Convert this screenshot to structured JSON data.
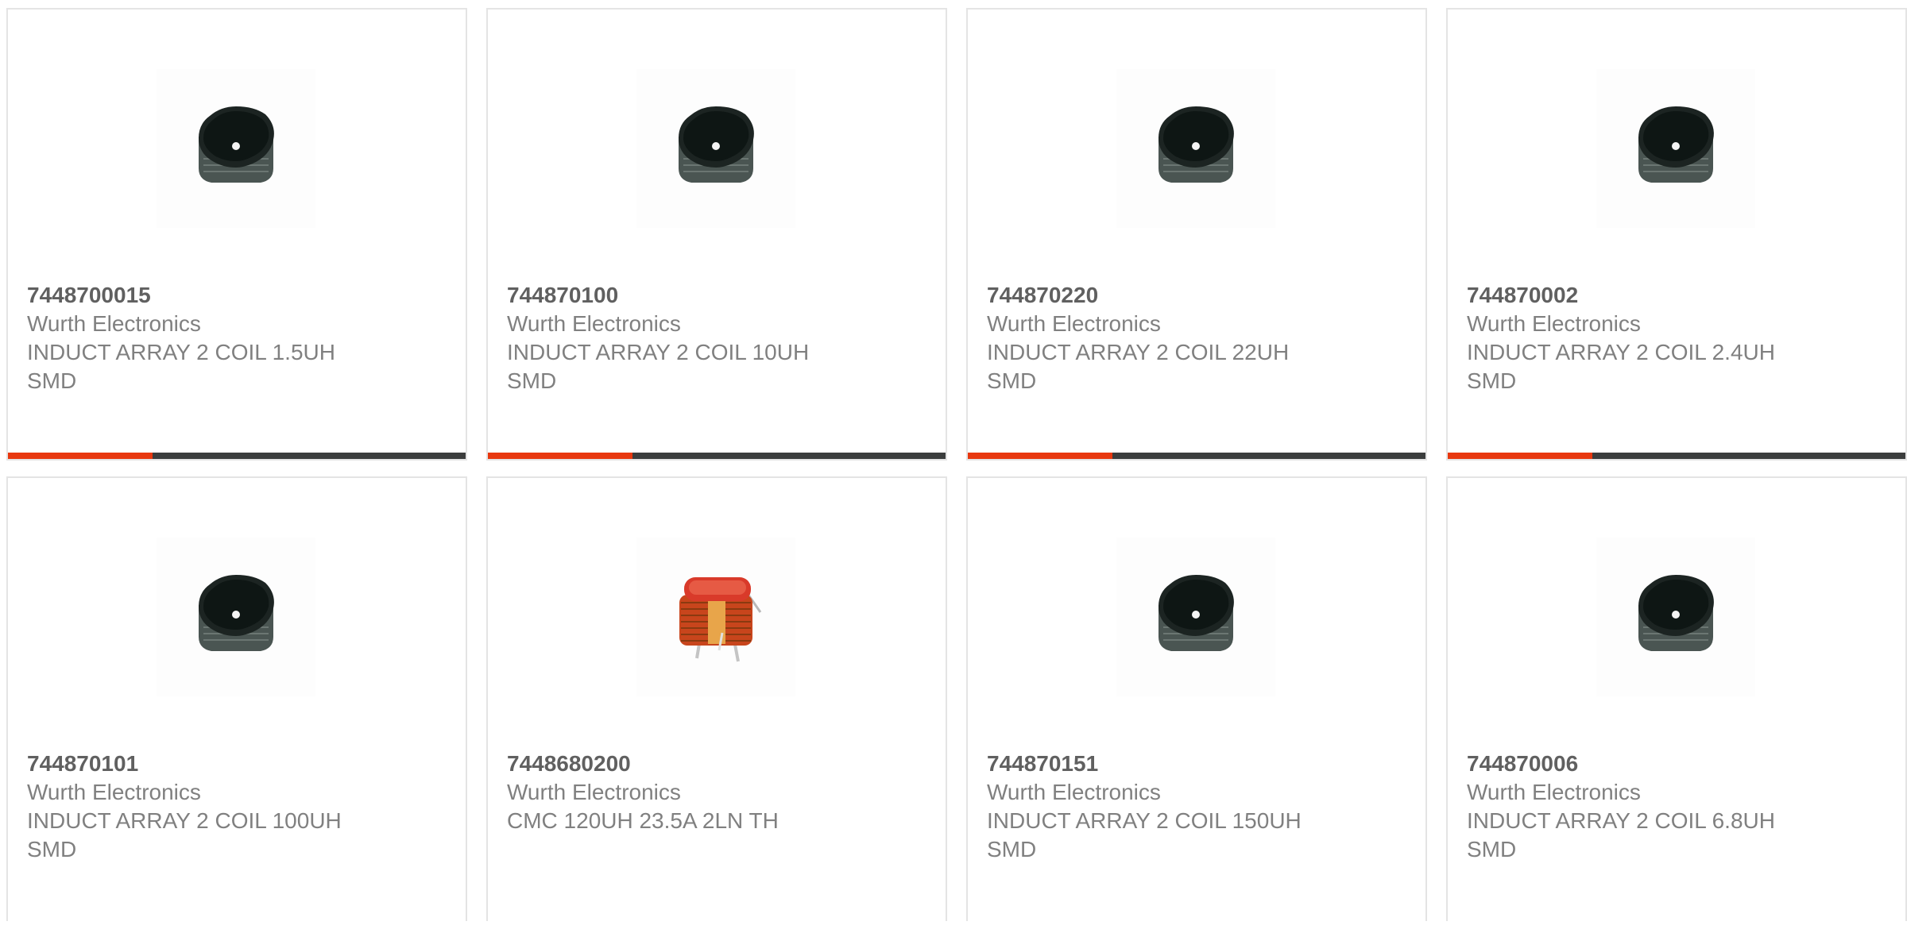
{
  "products": [
    {
      "part_number": "7448700015",
      "manufacturer": "Wurth Electronics",
      "description": "INDUCT ARRAY 2 COIL 1.5UH",
      "package": "SMD",
      "image": "smd-inductor-image",
      "show_bar": true
    },
    {
      "part_number": "744870100",
      "manufacturer": "Wurth Electronics",
      "description": "INDUCT ARRAY 2 COIL 10UH",
      "package": "SMD",
      "image": "smd-inductor-image",
      "show_bar": true
    },
    {
      "part_number": "744870220",
      "manufacturer": "Wurth Electronics",
      "description": "INDUCT ARRAY 2 COIL 22UH",
      "package": "SMD",
      "image": "smd-inductor-image",
      "show_bar": true
    },
    {
      "part_number": "744870002",
      "manufacturer": "Wurth Electronics",
      "description": "INDUCT ARRAY 2 COIL 2.4UH",
      "package": "SMD",
      "image": "smd-inductor-image",
      "show_bar": true
    },
    {
      "part_number": "744870101",
      "manufacturer": "Wurth Electronics",
      "description": "INDUCT ARRAY 2 COIL 100UH",
      "package": "SMD",
      "image": "smd-inductor-image",
      "show_bar": false
    },
    {
      "part_number": "7448680200",
      "manufacturer": "Wurth Electronics",
      "description": "CMC 120UH 23.5A 2LN TH",
      "package": "",
      "image": "common-mode-choke-image",
      "show_bar": false
    },
    {
      "part_number": "744870151",
      "manufacturer": "Wurth Electronics",
      "description": "INDUCT ARRAY 2 COIL 150UH",
      "package": "SMD",
      "image": "smd-inductor-image",
      "show_bar": false
    },
    {
      "part_number": "744870006",
      "manufacturer": "Wurth Electronics",
      "description": "INDUCT ARRAY 2 COIL 6.8UH",
      "package": "SMD",
      "image": "smd-inductor-image",
      "show_bar": false
    }
  ],
  "colors": {
    "accent": "#e8380f",
    "bar_dark": "#3b3d3d",
    "part_number_text": "#606060",
    "body_text": "#808080",
    "card_border": "#e4e4e4"
  }
}
